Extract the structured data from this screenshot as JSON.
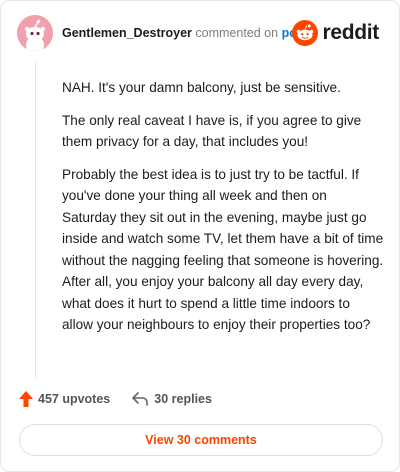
{
  "comment": {
    "author": "Gentlemen_Destroyer",
    "action_text": "commented on",
    "target_link": "post",
    "paragraphs": [
      "NAH. It's your damn balcony, just be sensitive.",
      "The only real caveat I have is, if you agree to give them privacy for a day, that includes you!",
      "Probably the best idea is to just try to be tactful. If you've done your thing all week and then on Saturday they sit out in the evening, maybe just go inside and watch some TV, let them have a bit of time without the nagging feeling that someone is hovering. After all, you enjoy your balcony all day every day, what does it hurt to spend a little time indoors to allow your neighbours to enjoy their properties too?"
    ],
    "upvotes": "457 upvotes",
    "replies": "30 replies",
    "view_comments": "View 30 comments"
  },
  "brand": {
    "logo_text": "reddit",
    "accent_color": "#ff4500",
    "link_color": "#0079d3"
  },
  "icons": {
    "avatar": "snoo-avatar-icon",
    "logo": "reddit-logo-icon",
    "upvote": "upvote-arrow-icon",
    "reply": "reply-arrow-icon"
  }
}
